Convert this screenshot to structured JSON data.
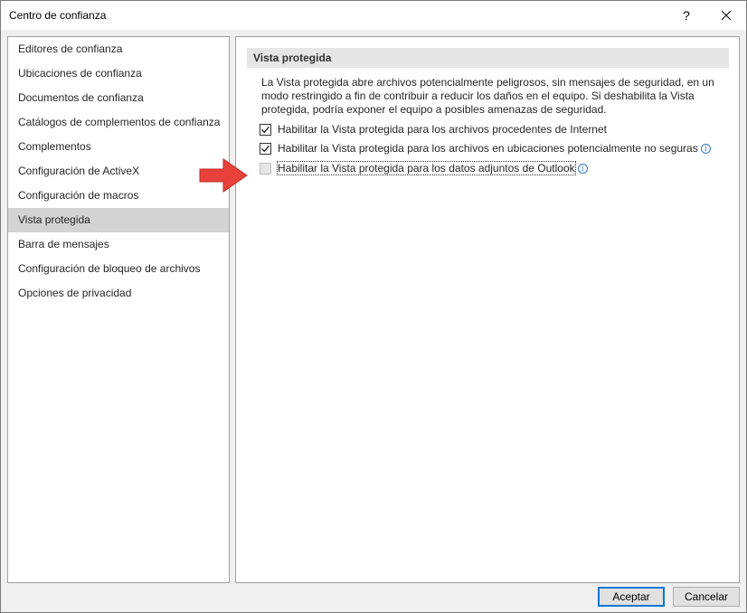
{
  "window": {
    "title": "Centro de confianza",
    "help": "?",
    "close_icon": "close-icon"
  },
  "sidebar": {
    "items": [
      {
        "label": "Editores de confianza",
        "selected": false
      },
      {
        "label": "Ubicaciones de confianza",
        "selected": false
      },
      {
        "label": "Documentos de confianza",
        "selected": false
      },
      {
        "label": "Catálogos de complementos de confianza",
        "selected": false
      },
      {
        "label": "Complementos",
        "selected": false
      },
      {
        "label": "Configuración de ActiveX",
        "selected": false
      },
      {
        "label": "Configuración de macros",
        "selected": false
      },
      {
        "label": "Vista protegida",
        "selected": true
      },
      {
        "label": "Barra de mensajes",
        "selected": false
      },
      {
        "label": "Configuración de bloqueo de archivos",
        "selected": false
      },
      {
        "label": "Opciones de privacidad",
        "selected": false
      }
    ]
  },
  "main": {
    "section_title": "Vista protegida",
    "description": "La Vista protegida abre archivos potencialmente peligrosos, sin mensajes de seguridad, en un modo restringido a fin de contribuir a reducir los daños en el equipo. Si deshabilita la Vista protegida, podría exponer el equipo a posibles amenazas de seguridad.",
    "options": [
      {
        "label": "Habilitar la Vista protegida para los archivos procedentes de Internet",
        "checked": true,
        "enabled": true,
        "info": false
      },
      {
        "label": "Habilitar la Vista protegida para los archivos en ubicaciones potencialmente no seguras",
        "checked": true,
        "enabled": true,
        "info": true
      },
      {
        "label": "Habilitar la Vista protegida para los datos adjuntos de Outlook",
        "checked": false,
        "enabled": false,
        "info": true
      }
    ],
    "info_glyph": "i"
  },
  "footer": {
    "ok_label": "Aceptar",
    "cancel_label": "Cancelar"
  },
  "colors": {
    "arrow": "#e8413b",
    "selected_item": "#d3d3d3",
    "default_button_border": "#0078d7"
  }
}
